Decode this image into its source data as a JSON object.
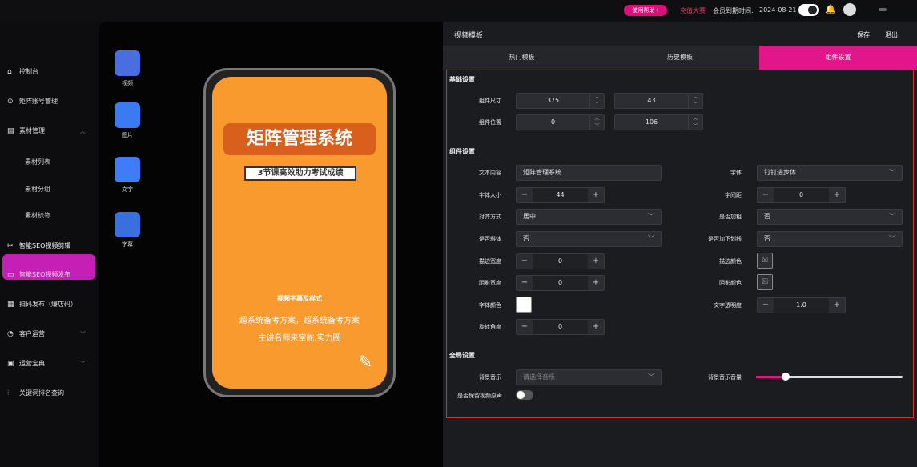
{
  "topbar": {
    "help_label": "使用帮助 ›",
    "link_red": "充值大赛",
    "member_label": "会员到期时间:",
    "member_date": "2024-08-21"
  },
  "sidebar": {
    "items": [
      {
        "label": "控制台",
        "icon": "home-icon"
      },
      {
        "label": "矩阵账号管理",
        "icon": "account-icon"
      },
      {
        "label": "素材管理",
        "icon": "folder-icon"
      },
      {
        "label": "智能SEO视频剪辑",
        "icon": "scissors-icon"
      },
      {
        "label": "智能SEO视频发布",
        "icon": "video-icon"
      },
      {
        "label": "扫码发布（爆店码）",
        "icon": "qr-icon"
      },
      {
        "label": "客户运营",
        "icon": "customer-icon"
      },
      {
        "label": "运营宝典",
        "icon": "book-icon"
      },
      {
        "label": "关键词排名查询",
        "icon": "rank-icon"
      }
    ],
    "sub_items": [
      "素材列表",
      "素材分组",
      "素材标签"
    ]
  },
  "tools": [
    {
      "label": "视频",
      "icon": "video-tool-icon",
      "color": "#4a6ee0"
    },
    {
      "label": "图片",
      "icon": "image-tool-icon",
      "color": "#3b7af0"
    },
    {
      "label": "文字",
      "icon": "text-tool-icon",
      "color": "#3f7cf5"
    },
    {
      "label": "字幕",
      "icon": "subtitle-tool-icon",
      "color": "#3a6fe0"
    }
  ],
  "phone": {
    "banner_title": "矩阵管理系统",
    "banner_sub": "3节课高效助力考试成绩",
    "caption_title": "视频字幕及样式",
    "caption_line1": "超系统备考方案，超系统备考方案",
    "caption_line2": "主讲名师来掌舵,实力圈"
  },
  "editor": {
    "title": "视频模板",
    "save": "保存",
    "exit": "退出",
    "tabs": [
      "热门模板",
      "历史模板",
      "组件设置"
    ],
    "basic": {
      "section": "基础设置",
      "size_label": "组件尺寸",
      "size_w": "375",
      "size_h": "43",
      "pos_label": "组件位置",
      "pos_x": "0",
      "pos_y": "106"
    },
    "component": {
      "section": "组件设置",
      "text_label": "文本内容",
      "text_value": "矩阵管理系统",
      "font_label": "字体",
      "font_value": "钉钉进步体",
      "fontsize_label": "字体大小",
      "fontsize_value": "44",
      "spacing_label": "字间距",
      "spacing_value": "0",
      "align_label": "对齐方式",
      "align_value": "居中",
      "bold_label": "是否加粗",
      "bold_value": "否",
      "italic_label": "是否斜体",
      "italic_value": "否",
      "underline_label": "是否加下划线",
      "underline_value": "否",
      "stroke_w_label": "描边宽度",
      "stroke_w_value": "0",
      "stroke_c_label": "描边颜色",
      "shadow_w_label": "阴影宽度",
      "shadow_w_value": "0",
      "shadow_c_label": "阴影颜色",
      "color_label": "字体颜色",
      "opacity_label": "文字透明度",
      "opacity_value": "1.0",
      "rotate_label": "旋转角度",
      "rotate_value": "0"
    },
    "global": {
      "section": "全局设置",
      "bgm_label": "背景音乐",
      "bgm_placeholder": "请选择音乐",
      "volume_label": "背景音乐音量",
      "volume_fraction": 0.2,
      "keep_label": "是否保留视频原声"
    }
  },
  "colors": {
    "accent": "#e3158a",
    "sidebar_active": "#c51fb6",
    "phone_bg": "#f89a2e",
    "highlight_box": "#d3322c"
  }
}
